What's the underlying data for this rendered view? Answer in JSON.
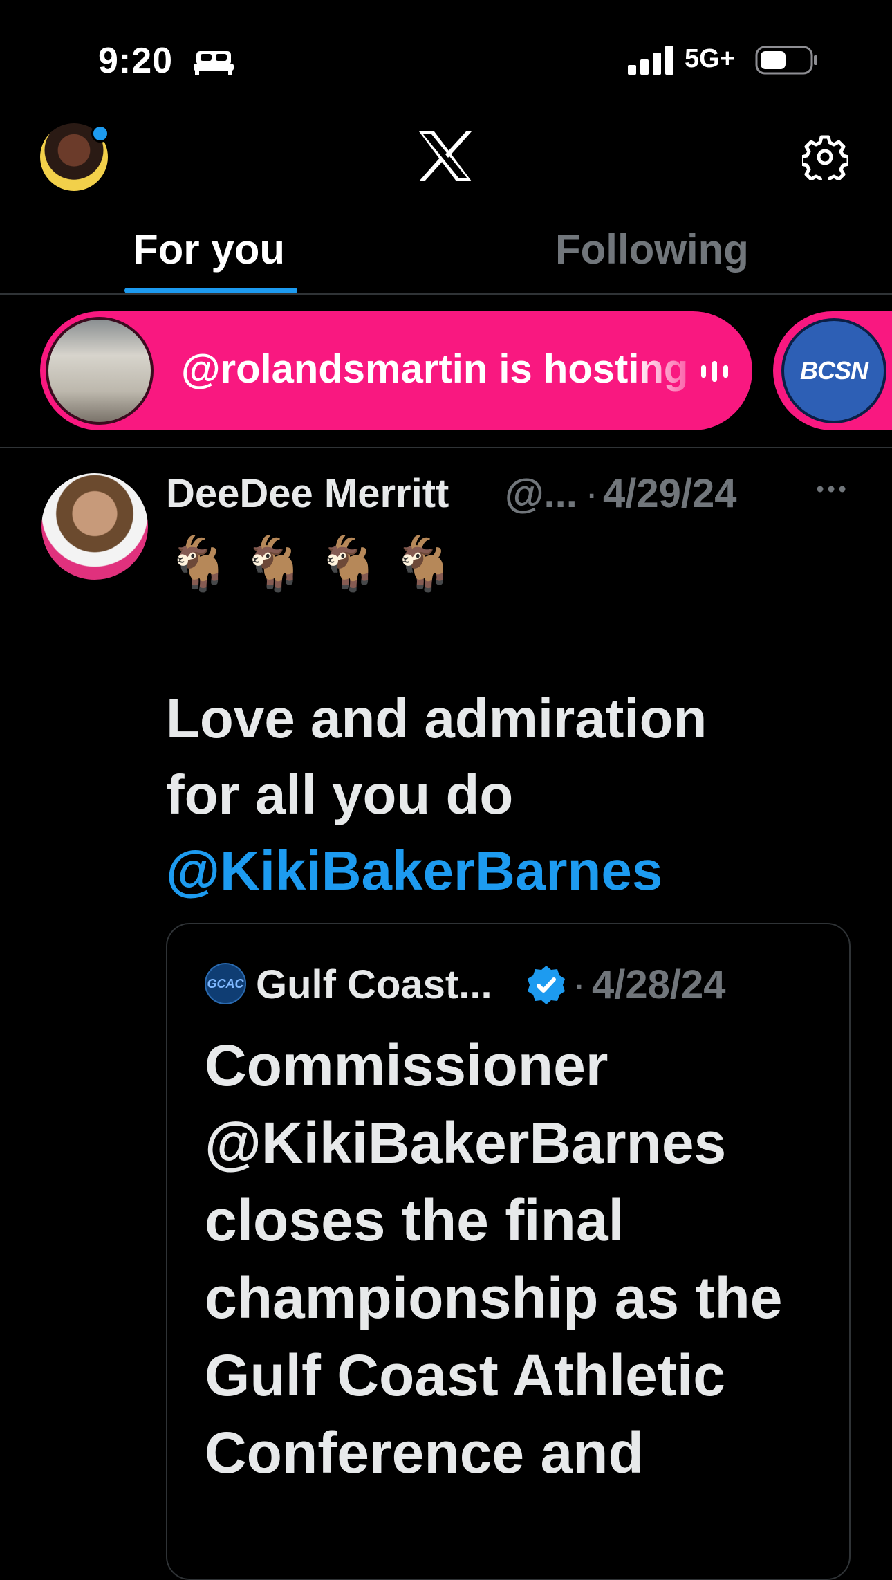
{
  "status_bar": {
    "time": "9:20",
    "network": "5G+"
  },
  "header": {
    "tabs": [
      {
        "label": "For you",
        "active": true
      },
      {
        "label": "Following",
        "active": false
      }
    ]
  },
  "spaces": [
    {
      "text": "@rolandsmartin is hosting"
    },
    {
      "logo_text": "BCSN"
    }
  ],
  "tweet": {
    "author_name": "DeeDee Merritt",
    "handle": "@...",
    "separator": "·",
    "date": "4/29/24",
    "emoji": "🐐🐐🐐🐐",
    "text_line1": "Love and admiration",
    "text_line2": "for all you do",
    "mention": "@KikiBakerBarnes",
    "quote": {
      "logo_text": "GCAC",
      "name": "Gulf Coast...",
      "separator": "·",
      "date": "4/28/24",
      "text": "Commissioner @KikiBakerBarnes closes the final championship as the Gulf Coast Athletic Conference and"
    }
  },
  "colors": {
    "accent": "#1d9bf0",
    "space_pink": "#f91880",
    "muted": "#71767b",
    "background": "#000000"
  }
}
